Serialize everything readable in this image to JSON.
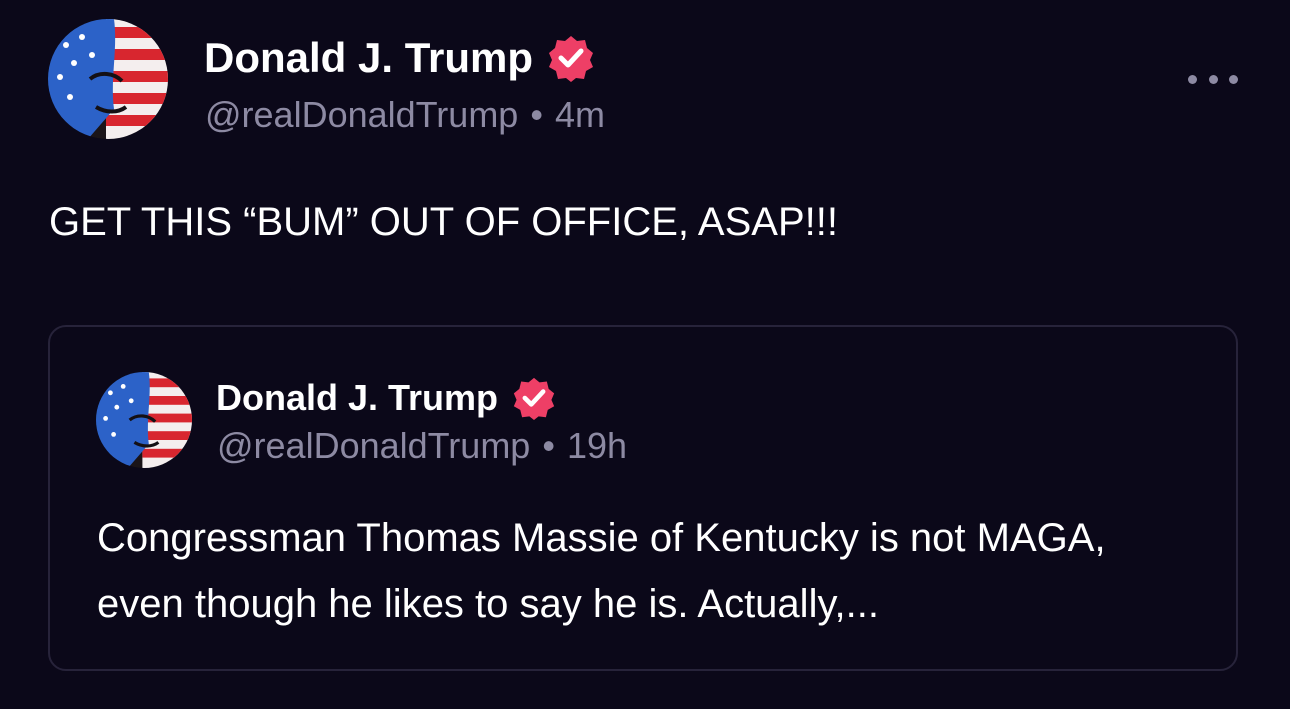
{
  "post": {
    "author": {
      "display_name": "Donald J. Trump",
      "handle": "@realDonaldTrump",
      "verified_icon": "verified-badge-icon",
      "avatar_icon": "avatar-flag-portrait"
    },
    "separator": "•",
    "timestamp": "4m",
    "text": "GET THIS “BUM” OUT OF OFFICE, ASAP!!!",
    "more_icon": "more-options-icon"
  },
  "quoted_post": {
    "author": {
      "display_name": "Donald J. Trump",
      "handle": "@realDonaldTrump"
    },
    "separator": "•",
    "timestamp": "19h",
    "text": "Congressman Thomas Massie of Kentucky is not MAGA, even though he likes to say he is. Actually,..."
  },
  "colors": {
    "background": "#0b0819",
    "text_primary": "#ffffff",
    "text_secondary": "#8d8aa3",
    "badge": "#ee3f66",
    "card_border": "#27233a"
  }
}
